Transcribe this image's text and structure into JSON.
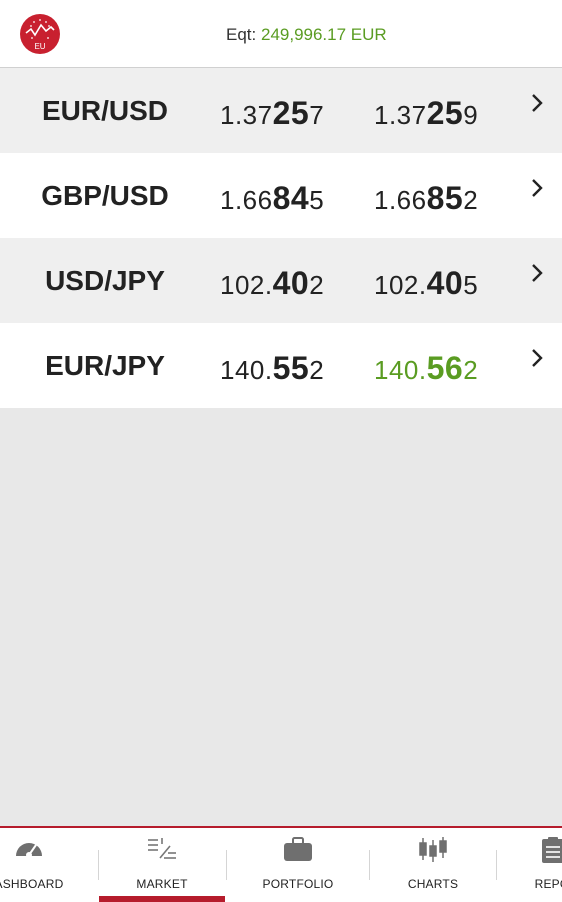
{
  "header": {
    "logo_text": "EU",
    "equity_label": "Eqt:",
    "equity_value": "249,996.17 EUR"
  },
  "quotes": [
    {
      "pair": "EUR/USD",
      "bid_pre": "1.37",
      "bid_big": "25",
      "bid_post": "7",
      "ask_pre": "1.37",
      "ask_big": "25",
      "ask_post": "9"
    },
    {
      "pair": "GBP/USD",
      "bid_pre": "1.66",
      "bid_big": "84",
      "bid_post": "5",
      "ask_pre": "1.66",
      "ask_big": "85",
      "ask_post": "2"
    },
    {
      "pair": "USD/JPY",
      "bid_pre": "102.",
      "bid_big": "40",
      "bid_post": "2",
      "ask_pre": "102.",
      "ask_big": "40",
      "ask_post": "5"
    },
    {
      "pair": "EUR/JPY",
      "bid_pre": "140.",
      "bid_big": "55",
      "bid_post": "2",
      "ask_pre": "140.",
      "ask_big": "56",
      "ask_post": "2"
    }
  ],
  "tabs": {
    "dashboard": "ASHBOARD",
    "market": "MARKET",
    "portfolio": "PORTFOLIO",
    "charts": "CHARTS",
    "reports": "REPO"
  },
  "colors": {
    "brand_red": "#b61c2c",
    "positive_green": "#5a9c22"
  }
}
